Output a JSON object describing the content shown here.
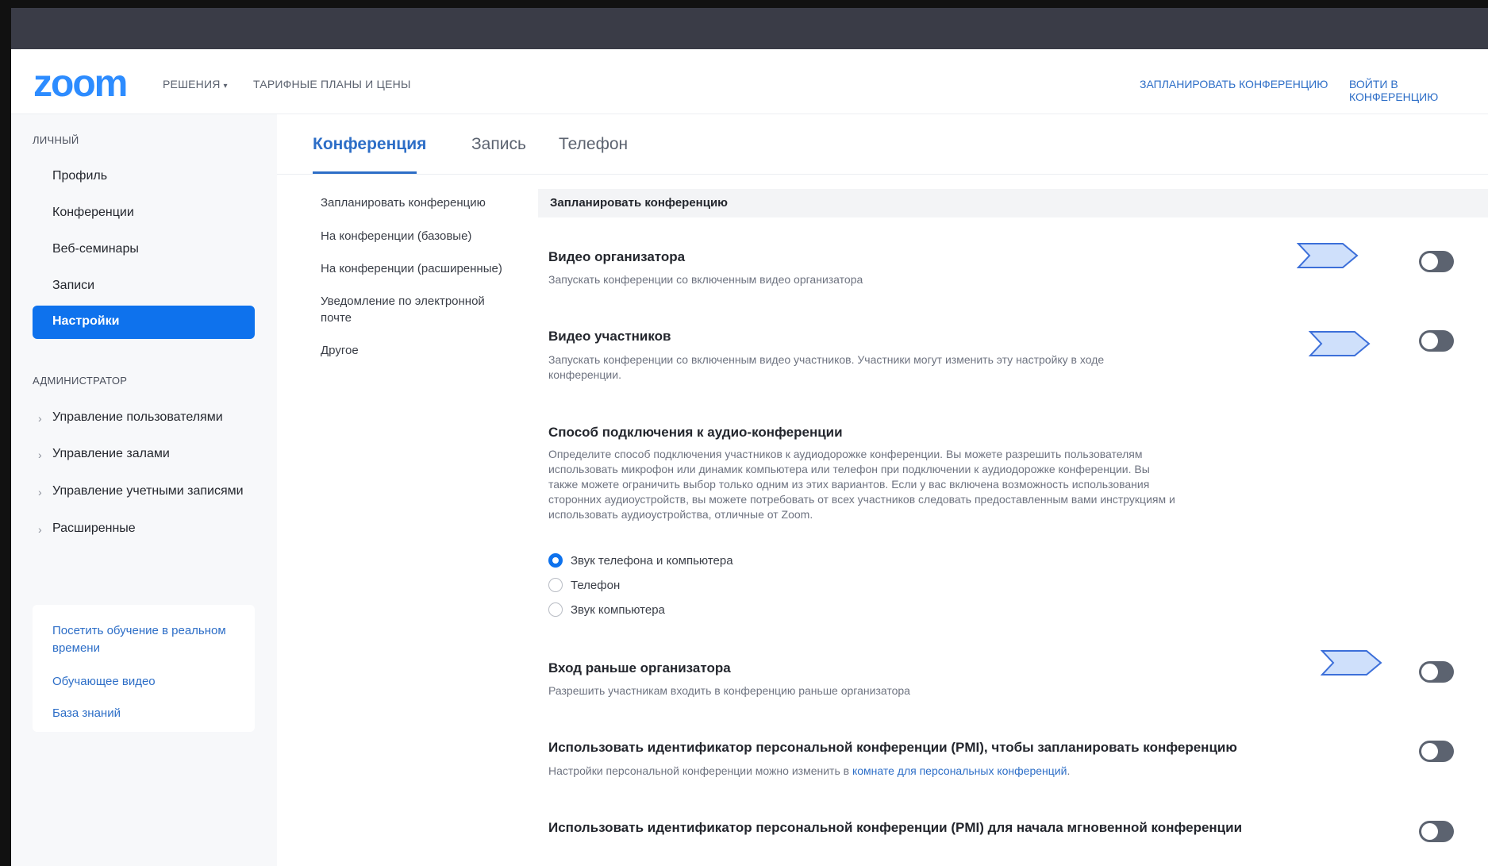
{
  "header": {
    "logo": "zoom",
    "nav": {
      "solutions": "РЕШЕНИЯ",
      "solutions_caret": "▾",
      "plans": "ТАРИФНЫЕ ПЛАНЫ И ЦЕНЫ"
    },
    "schedule": "ЗАПЛАНИРОВАТЬ КОНФЕРЕНЦИЮ",
    "join": "ВОЙТИ В КОНФЕРЕНЦИЮ"
  },
  "sidebar": {
    "personal_label": "ЛИЧНЫЙ",
    "personal_items": [
      "Профиль",
      "Конференции",
      "Веб-семинары",
      "Записи",
      "Настройки"
    ],
    "admin_label": "АДМИНИСТРАТОР",
    "admin_items": [
      "Управление пользователями",
      "Управление залами",
      "Управление учетными записями",
      "Расширенные"
    ],
    "chevron": "›",
    "help_links": [
      "Посетить обучение в реальном времени",
      "Обучающее видео",
      "База знаний"
    ]
  },
  "tabs": [
    "Конференция",
    "Запись",
    "Телефон"
  ],
  "subnav": [
    "Запланировать конференцию",
    "На конференции (базовые)",
    "На конференции (расширенные)",
    "Уведомление по электронной почте",
    "Другое"
  ],
  "section_header": "Запланировать конференцию",
  "settings": {
    "host_video": {
      "title": "Видео организатора",
      "desc": "Запускать конференции со включенным видео организатора",
      "enabled": false
    },
    "participant_video": {
      "title": "Видео участников",
      "desc": "Запускать конференции со включенным видео участников. Участники могут изменить эту настройку в ходе конференции.",
      "enabled": false
    },
    "audio_type": {
      "title": "Способ подключения к аудио-конференции",
      "desc": "Определите способ подключения участников к аудиодорожке конференции. Вы можете разрешить пользователям использовать микрофон или динамик компьютера или телефон при подключении к аудиодорожке конференции. Вы также можете ограничить выбор только одним из этих вариантов. Если у вас включена возможность использования сторонних аудиоустройств, вы можете потребовать от всех участников следовать предоставленным вами инструкциям и использовать аудиоустройства, отличные от Zoom.",
      "options": [
        "Звук телефона и компьютера",
        "Телефон",
        "Звук компьютера"
      ],
      "selected": "Звук телефона и компьютера"
    },
    "join_before_host": {
      "title": "Вход раньше организатора",
      "desc": "Разрешить участникам входить в конференцию раньше организатора",
      "enabled": false
    },
    "pmi_schedule": {
      "title": "Использовать идентификатор персональной конференции (PMI), чтобы запланировать конференцию",
      "desc_prefix": "Настройки персональной конференции можно изменить в ",
      "desc_link": "комнате для персональных конференций",
      "desc_suffix": ".",
      "enabled": false
    },
    "pmi_instant": {
      "title": "Использовать идентификатор персональной конференции (PMI) для начала мгновенной конференции",
      "enabled": false
    }
  },
  "colors": {
    "brand": "#2d8cff",
    "active_nav": "#0e72ed",
    "link": "#2d6ec7",
    "toggle_off": "#5c6370",
    "topbar": "#3a3c47"
  }
}
